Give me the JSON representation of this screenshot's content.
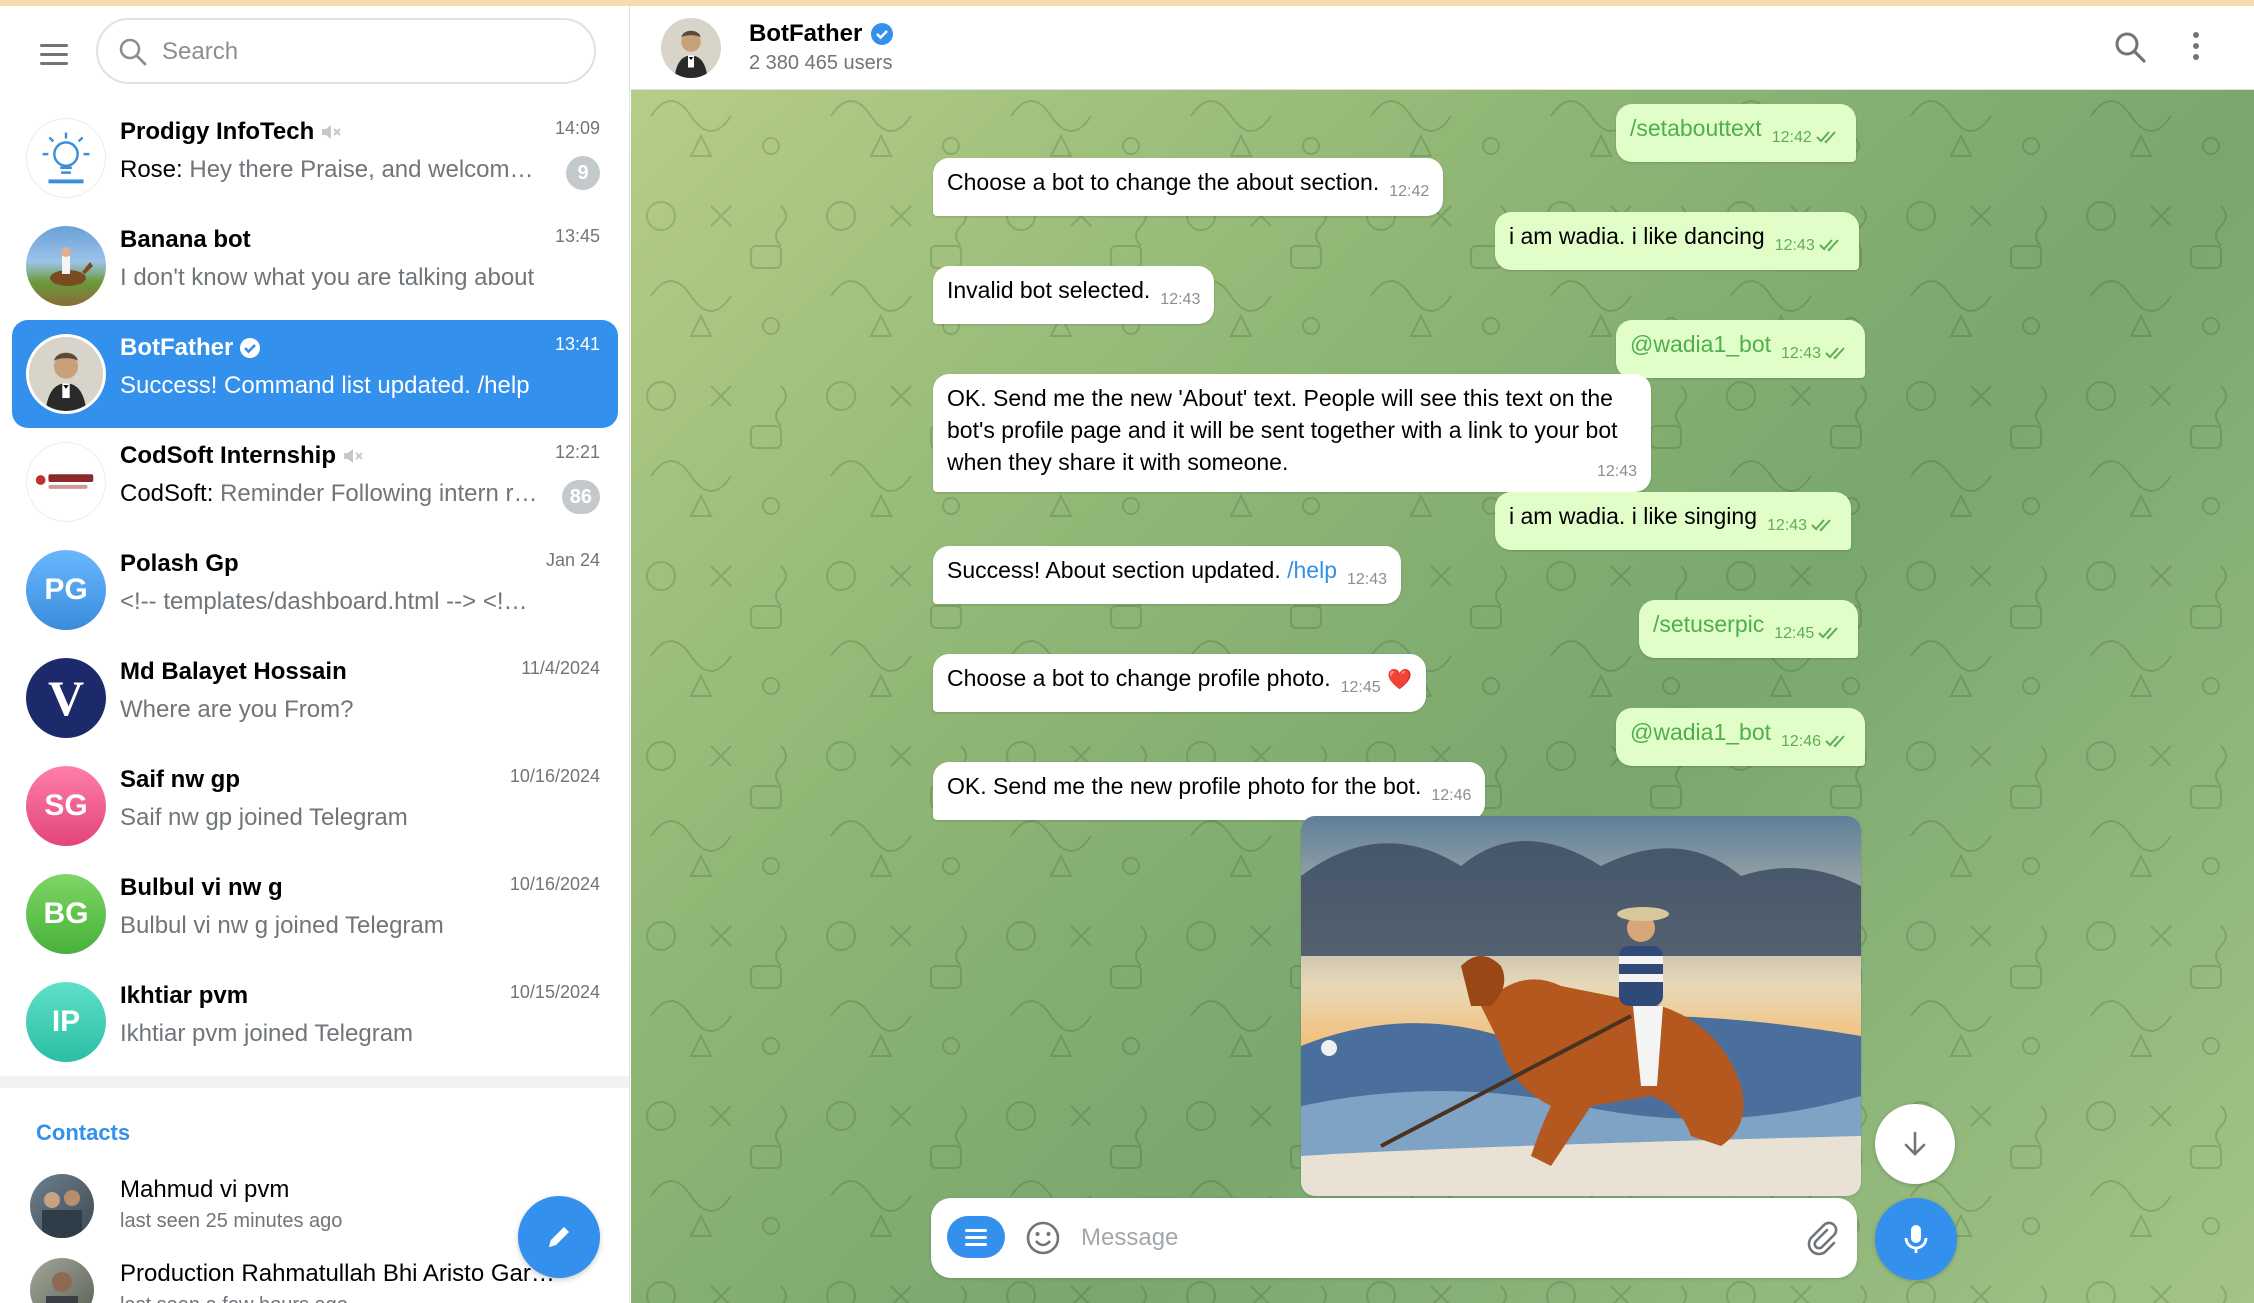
{
  "sidebar": {
    "search_placeholder": "Search",
    "chats": [
      {
        "name": "Prodigy InfoTech",
        "time": "14:09",
        "sender": "Rose:",
        "message": "Hey there Praise, and welcome to Prodigy InfoTech",
        "badge": "9",
        "muted": true
      },
      {
        "name": "Banana bot",
        "time": "13:45",
        "sender": "",
        "message": "I don't know what you are talking about",
        "badge": "",
        "muted": false
      },
      {
        "name": "BotFather",
        "time": "13:41",
        "sender": "",
        "message": "Success! Command list updated. /help",
        "badge": "",
        "muted": false,
        "verified": true
      },
      {
        "name": "CodSoft Internship",
        "time": "12:21",
        "sender": "CodSoft:",
        "message": "Reminder Following intern requirements",
        "badge": "86",
        "muted": true
      },
      {
        "name": "Polash Gp",
        "time": "Jan 24",
        "sender": "",
        "message": "<!-- templates/dashboard.html --> <!DOCTYPE html>",
        "badge": "",
        "initials": "PG"
      },
      {
        "name": "Md Balayet Hossain",
        "time": "11/4/2024",
        "sender": "",
        "message": "Where are you From?",
        "badge": "",
        "initials": "V"
      },
      {
        "name": "Saif nw gp",
        "time": "10/16/2024",
        "sender": "",
        "message": "Saif nw gp joined Telegram",
        "badge": "",
        "initials": "SG"
      },
      {
        "name": "Bulbul vi nw g",
        "time": "10/16/2024",
        "sender": "",
        "message": "Bulbul vi nw g joined Telegram",
        "badge": "",
        "initials": "BG"
      },
      {
        "name": "Ikhtiar pvm",
        "time": "10/15/2024",
        "sender": "",
        "message": "Ikhtiar pvm joined Telegram",
        "badge": "",
        "initials": "IP"
      }
    ],
    "contacts_title": "Contacts",
    "contacts": [
      {
        "name": "Mahmud vi pvm",
        "status": "last seen 25 minutes ago"
      },
      {
        "name": "Production Rahmatullah Bhi Aristo Garments",
        "status": "last seen a few hours ago"
      }
    ]
  },
  "header": {
    "name": "BotFather",
    "subtitle": "2 380 465 users"
  },
  "messages": [
    {
      "dir": "out",
      "text": "/setabouttext",
      "time": "12:42",
      "cmd": true
    },
    {
      "dir": "in",
      "text": "Choose a bot to change the about section.",
      "time": "12:42"
    },
    {
      "dir": "out",
      "text": "i am wadia. i like dancing",
      "time": "12:43"
    },
    {
      "dir": "in",
      "text": "Invalid bot selected.",
      "time": "12:43"
    },
    {
      "dir": "out",
      "text": "@wadia1_bot",
      "time": "12:43",
      "cmd": true
    },
    {
      "dir": "in",
      "text": "OK. Send me the new 'About' text. People will see this text on the bot's profile page and it will be sent together with a link to your bot when they share it with someone.",
      "time": "12:43"
    },
    {
      "dir": "out",
      "text": "i am wadia.  i like singing",
      "time": "12:43"
    },
    {
      "dir": "in",
      "text": "Success! About section updated.",
      "link": "/help",
      "time": "12:43"
    },
    {
      "dir": "out",
      "text": "/setuserpic",
      "time": "12:45",
      "cmd": true
    },
    {
      "dir": "in",
      "text": "Choose a bot to change profile photo.",
      "time": "12:45",
      "reaction": "❤️"
    },
    {
      "dir": "out",
      "text": "@wadia1_bot",
      "time": "12:46",
      "cmd": true
    },
    {
      "dir": "in",
      "text": "OK. Send me the new profile photo for the bot.",
      "time": "12:46"
    }
  ],
  "composer": {
    "placeholder": "Message"
  },
  "colors": {
    "accent": "#3390ec",
    "outgoing_bubble": "#e2fec8",
    "incoming_bubble": "#ffffff"
  }
}
